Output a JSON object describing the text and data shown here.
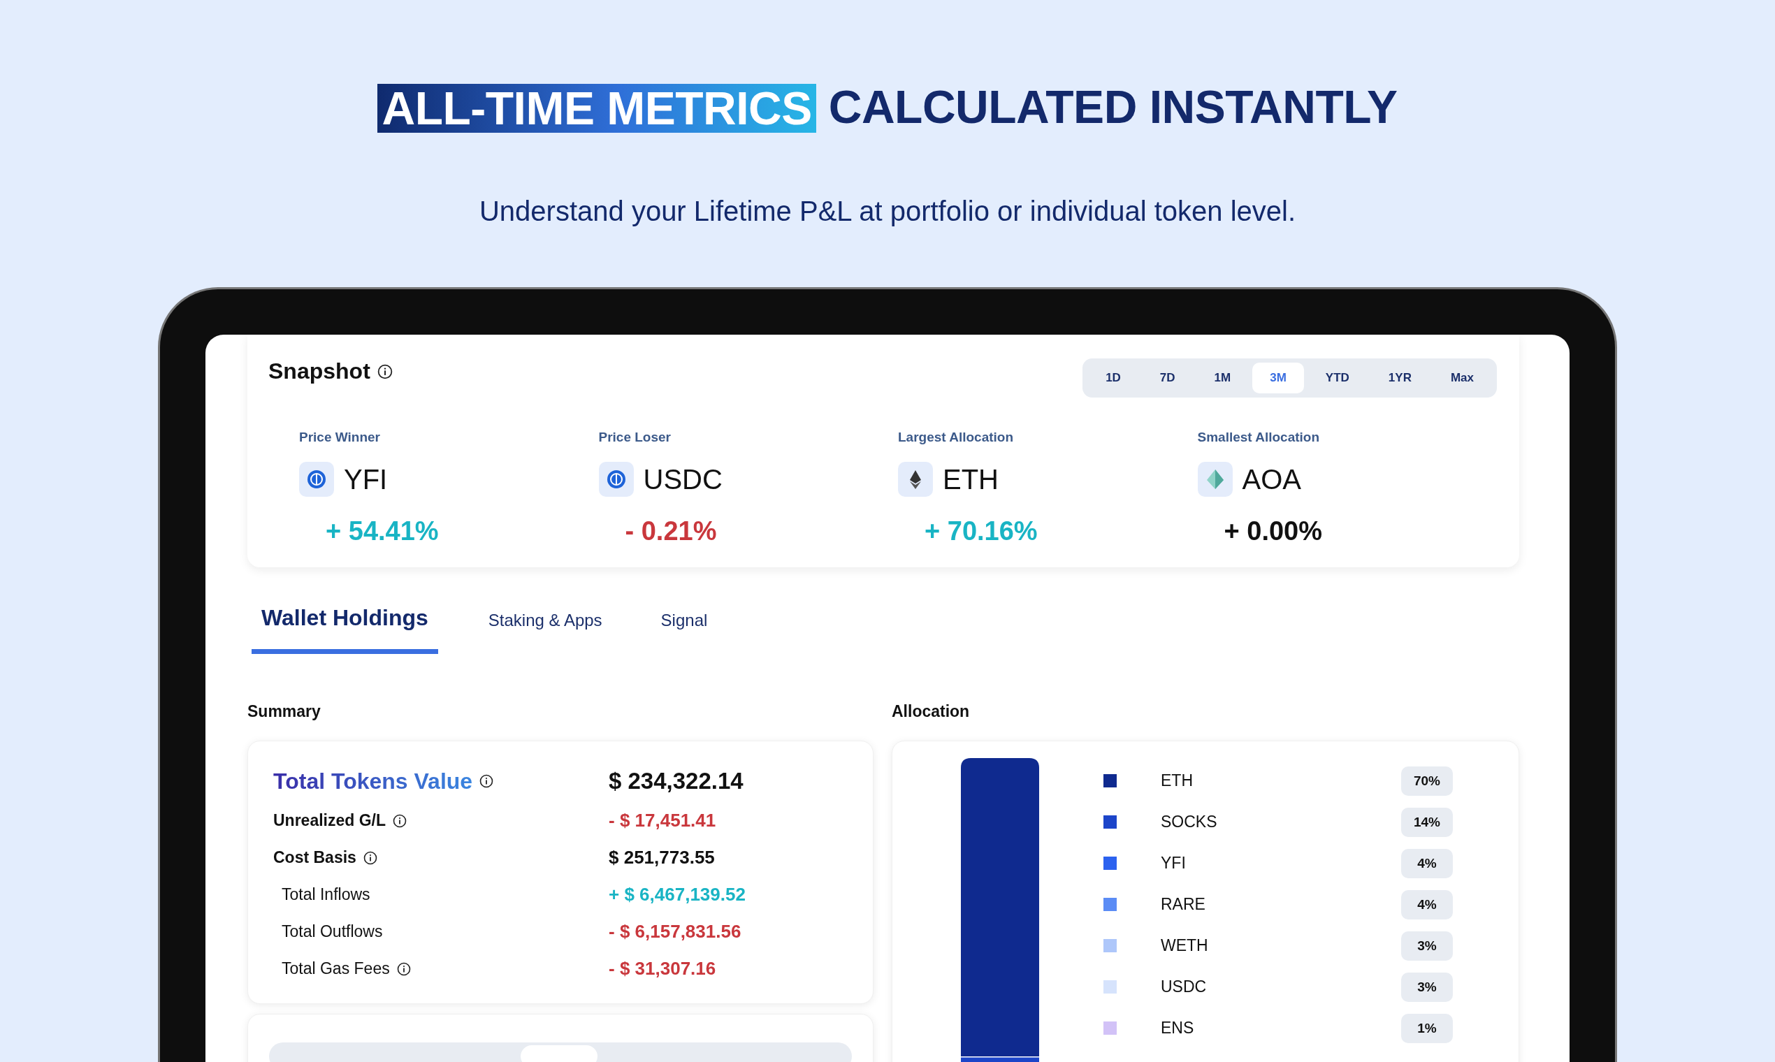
{
  "headline": {
    "highlight": "ALL-TIME METRICS",
    "rest": "CALCULATED INSTANTLY"
  },
  "subtitle": "Understand your Lifetime P&L at portfolio or individual token level.",
  "snapshot": {
    "title": "Snapshot",
    "ranges": [
      {
        "label": "1D",
        "selected": false
      },
      {
        "label": "7D",
        "selected": false
      },
      {
        "label": "1M",
        "selected": false
      },
      {
        "label": "3M",
        "selected": true
      },
      {
        "label": "YTD",
        "selected": false
      },
      {
        "label": "1YR",
        "selected": false
      },
      {
        "label": "Max",
        "selected": false
      }
    ],
    "metrics": [
      {
        "label": "Price Winner",
        "token": "YFI",
        "kind": "coin",
        "change": "+ 54.41%",
        "color": "#19b4c4"
      },
      {
        "label": "Price Loser",
        "token": "USDC",
        "kind": "coin",
        "change": "- 0.21%",
        "color": "#c9373c"
      },
      {
        "label": "Largest Allocation",
        "token": "ETH",
        "kind": "diamond",
        "change": "+ 70.16%",
        "color": "#19b4c4"
      },
      {
        "label": "Smallest Allocation",
        "token": "AOA",
        "kind": "pyramid",
        "change": "+ 0.00%",
        "color": "#111111"
      }
    ]
  },
  "tabs": [
    {
      "label": "Wallet Holdings",
      "selected": true
    },
    {
      "label": "Staking & Apps",
      "selected": false
    },
    {
      "label": "Signal",
      "selected": false
    }
  ],
  "summary": {
    "title": "Summary",
    "rows": [
      {
        "kind": "total",
        "label": "Total Tokens Value",
        "info": true,
        "value": "$ 234,322.14",
        "color": "#111111"
      },
      {
        "kind": "main",
        "label": "Unrealized G/L",
        "info": true,
        "value": "- $ 17,451.41",
        "color": "#c9373c"
      },
      {
        "kind": "main",
        "label": "Cost Basis",
        "info": true,
        "value": "$ 251,773.55",
        "color": "#111111"
      },
      {
        "kind": "sub",
        "label": "Total Inflows",
        "info": false,
        "value": "+ $ 6,467,139.52",
        "color": "#19b4c4"
      },
      {
        "kind": "sub",
        "label": "Total Outflows",
        "info": false,
        "value": "- $ 6,157,831.56",
        "color": "#c9373c"
      },
      {
        "kind": "sub",
        "label": "Total Gas Fees",
        "info": true,
        "value": "- $ 31,307.16",
        "color": "#c9373c"
      }
    ]
  },
  "allocation": {
    "title": "Allocation",
    "items": [
      {
        "name": "ETH",
        "share": "70%",
        "color": "#0f2a8f"
      },
      {
        "name": "SOCKS",
        "share": "14%",
        "color": "#1c45c9"
      },
      {
        "name": "YFI",
        "share": "4%",
        "color": "#2c62ef"
      },
      {
        "name": "RARE",
        "share": "4%",
        "color": "#5b8cf5"
      },
      {
        "name": "WETH",
        "share": "3%",
        "color": "#aec7fa"
      },
      {
        "name": "USDC",
        "share": "3%",
        "color": "#d6e3fc"
      },
      {
        "name": "ENS",
        "share": "1%",
        "color": "#d2c2f7"
      }
    ]
  }
}
